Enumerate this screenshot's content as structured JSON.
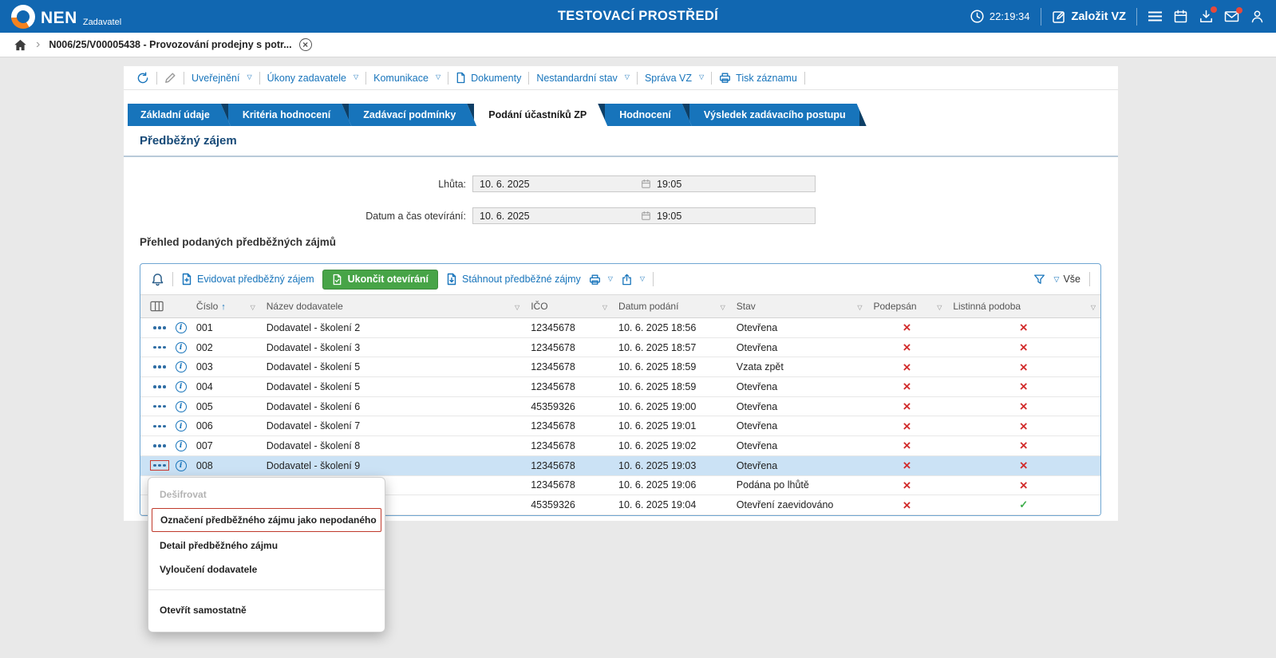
{
  "colors": {
    "topbar_blue": "#1167b1",
    "primary_blue": "#1774bb",
    "accent_orange": "#f5821f",
    "success_green": "#47a447",
    "error_red": "#d22d2d",
    "selected_row": "#cbe2f5"
  },
  "topbar": {
    "brand": "NEN",
    "brand_sub": "Zadavatel",
    "env_title": "TESTOVACÍ PROSTŘEDÍ",
    "time": "22:19:34",
    "new_vz_label": "Založit VZ"
  },
  "breadcrumb": {
    "record_tab": "N006/25/V00005438 - Provozování prodejny s potr..."
  },
  "record_toolbar": {
    "items": [
      {
        "label": "Uveřejnění",
        "caret": true
      },
      {
        "label": "Úkony zadavatele",
        "caret": true
      },
      {
        "label": "Komunikace",
        "caret": true
      },
      {
        "label": "Dokumenty",
        "icon": "document"
      },
      {
        "label": "Nestandardní stav",
        "caret": true
      },
      {
        "label": "Správa VZ",
        "caret": true
      },
      {
        "label": "Tisk záznamu",
        "icon": "printer"
      }
    ]
  },
  "tabs": [
    {
      "label": "Základní údaje",
      "active": false
    },
    {
      "label": "Kritéria hodnocení",
      "active": false
    },
    {
      "label": "Zadávací podmínky",
      "active": false
    },
    {
      "label": "Podání účastníků ZP",
      "active": true
    },
    {
      "label": "Hodnocení",
      "active": false
    },
    {
      "label": "Výsledek zadávacího postupu",
      "active": false
    }
  ],
  "section": {
    "title": "Předběžný zájem"
  },
  "form": {
    "rows": [
      {
        "label": "Lhůta:",
        "date": "10. 6. 2025",
        "time": "19:05"
      },
      {
        "label": "Datum a čas otevírání:",
        "date": "10. 6. 2025",
        "time": "19:05"
      }
    ]
  },
  "grid": {
    "title": "Přehled podaných předběžných zájmů",
    "toolbar": {
      "record_link": "Evidovat předběžný zájem",
      "finish_button": "Ukončit otevírání",
      "download_link": "Stáhnout předběžné zájmy",
      "filter_all": "Vše"
    },
    "columns": {
      "cislo": "Číslo",
      "nazev": "Název dodavatele",
      "ico": "IČO",
      "datum": "Datum podání",
      "stav": "Stav",
      "podepsan": "Podepsán",
      "listinna": "Listinná podoba"
    },
    "sort": {
      "column": "cislo",
      "direction": "asc"
    },
    "rows": [
      {
        "cislo": "001",
        "nazev": "Dodavatel - školení 2",
        "ico": "12345678",
        "datum": "10. 6. 2025 18:56",
        "stav": "Otevřena",
        "podepsan": "cross",
        "listinna": "cross"
      },
      {
        "cislo": "002",
        "nazev": "Dodavatel - školení 3",
        "ico": "12345678",
        "datum": "10. 6. 2025 18:57",
        "stav": "Otevřena",
        "podepsan": "cross",
        "listinna": "cross"
      },
      {
        "cislo": "003",
        "nazev": "Dodavatel - školení 5",
        "ico": "12345678",
        "datum": "10. 6. 2025 18:59",
        "stav": "Vzata zpět",
        "podepsan": "cross",
        "listinna": "cross"
      },
      {
        "cislo": "004",
        "nazev": "Dodavatel - školení 5",
        "ico": "12345678",
        "datum": "10. 6. 2025 18:59",
        "stav": "Otevřena",
        "podepsan": "cross",
        "listinna": "cross"
      },
      {
        "cislo": "005",
        "nazev": "Dodavatel - školení 6",
        "ico": "45359326",
        "datum": "10. 6. 2025 19:00",
        "stav": "Otevřena",
        "podepsan": "cross",
        "listinna": "cross"
      },
      {
        "cislo": "006",
        "nazev": "Dodavatel - školení 7",
        "ico": "12345678",
        "datum": "10. 6. 2025 19:01",
        "stav": "Otevřena",
        "podepsan": "cross",
        "listinna": "cross"
      },
      {
        "cislo": "007",
        "nazev": "Dodavatel - školení 8",
        "ico": "12345678",
        "datum": "10. 6. 2025 19:02",
        "stav": "Otevřena",
        "podepsan": "cross",
        "listinna": "cross"
      },
      {
        "cislo": "008",
        "nazev": "Dodavatel - školení 9",
        "ico": "12345678",
        "datum": "10. 6. 2025 19:03",
        "stav": "Otevřena",
        "podepsan": "cross",
        "listinna": "cross",
        "selected": true,
        "menu_open": true
      },
      {
        "cislo": "",
        "nazev": "",
        "ico": "12345678",
        "datum": "10. 6. 2025 19:06",
        "stav": "Podána po lhůtě",
        "podepsan": "cross",
        "listinna": "cross"
      },
      {
        "cislo": "",
        "nazev": "",
        "ico": "45359326",
        "datum": "10. 6. 2025 19:04",
        "stav": "Otevření zaevidováno",
        "podepsan": "cross",
        "listinna": "check"
      }
    ]
  },
  "context_menu": {
    "items": [
      {
        "label": "Dešifrovat",
        "disabled": true
      },
      {
        "label": "Označení předběžného zájmu jako nepodaného",
        "highlighted": true
      },
      {
        "label": "Detail předběžného zájmu"
      },
      {
        "label": "Vyloučení dodavatele"
      },
      {
        "label": "Otevřít samostatně",
        "separator_before": true
      }
    ]
  }
}
